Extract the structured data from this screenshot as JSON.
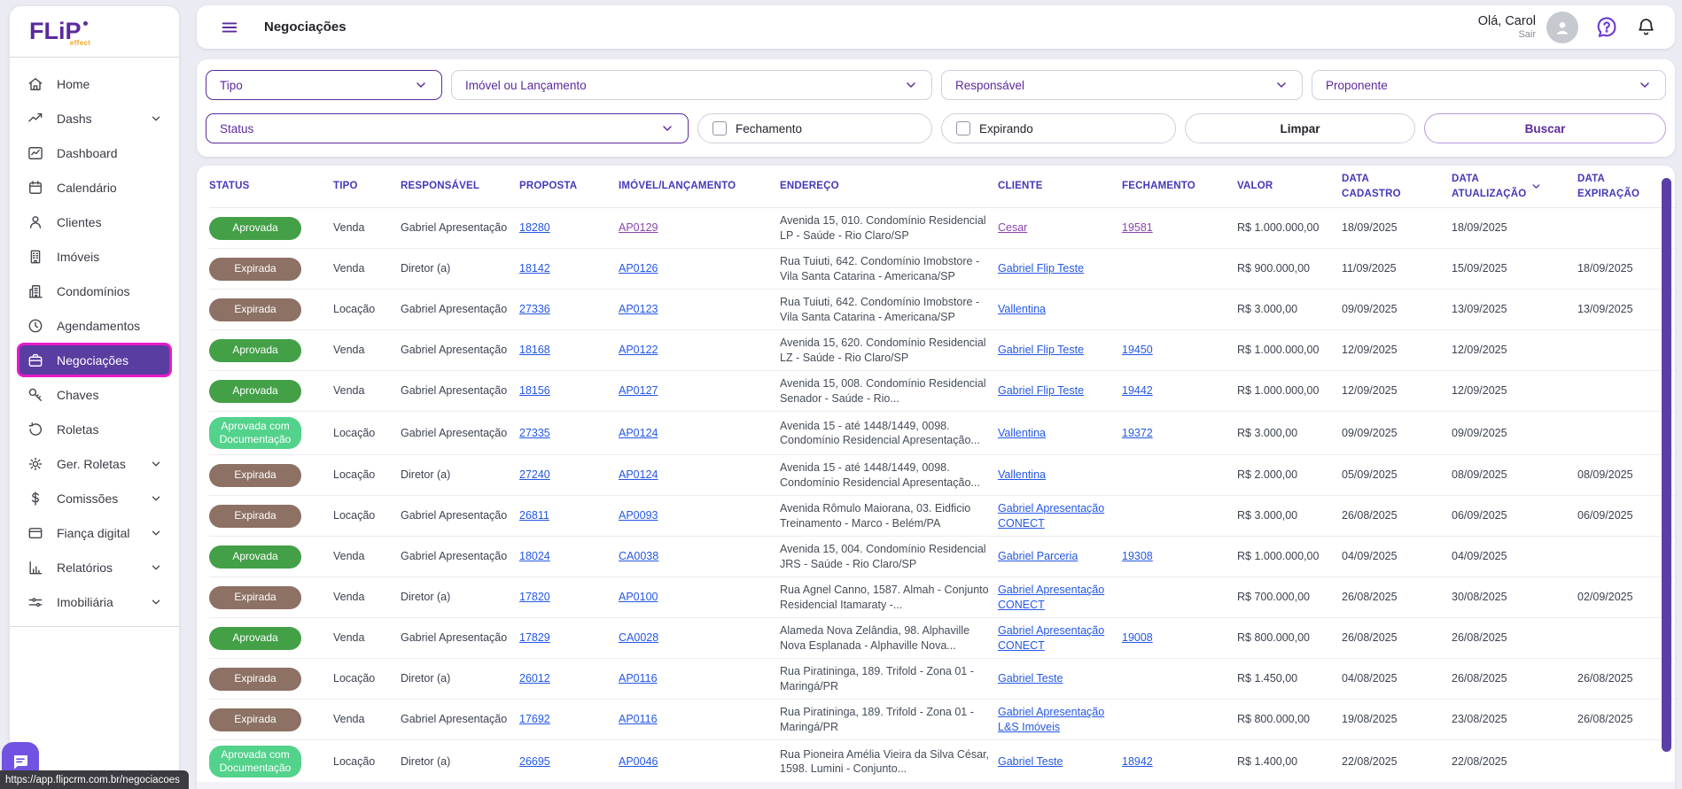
{
  "brand": {
    "name": "FLiP",
    "suffix": "effect"
  },
  "topbar": {
    "title": "Negociações",
    "greeting": "Olá, Carol",
    "logout": "Sair"
  },
  "filters": {
    "tipo": "Tipo",
    "imovel": "Imóvel ou Lançamento",
    "responsavel": "Responsável",
    "proponente": "Proponente",
    "status": "Status",
    "fechamento": "Fechamento",
    "expirando": "Expirando",
    "limpar": "Limpar",
    "buscar": "Buscar"
  },
  "sidebar": {
    "items": [
      {
        "label": "Home",
        "icon": "home"
      },
      {
        "label": "Dashs",
        "icon": "trending",
        "chevron": true
      },
      {
        "label": "Dashboard",
        "icon": "line-chart"
      },
      {
        "label": "Calendário",
        "icon": "calendar"
      },
      {
        "label": "Clientes",
        "icon": "person"
      },
      {
        "label": "Imóveis",
        "icon": "building"
      },
      {
        "label": "Condomínios",
        "icon": "buildings"
      },
      {
        "label": "Agendamentos",
        "icon": "clock"
      },
      {
        "label": "Negociações",
        "icon": "briefcase",
        "active": true
      },
      {
        "label": "Chaves",
        "icon": "key"
      },
      {
        "label": "Roletas",
        "icon": "rotate"
      },
      {
        "label": "Ger. Roletas",
        "icon": "gear",
        "chevron": true
      },
      {
        "label": "Comissões",
        "icon": "dollar",
        "chevron": true
      },
      {
        "label": "Fiança digital",
        "icon": "card",
        "chevron": true
      },
      {
        "label": "Relatórios",
        "icon": "bar-chart",
        "chevron": true
      },
      {
        "label": "Imobiliária",
        "icon": "sliders",
        "chevron": true
      }
    ]
  },
  "table": {
    "columns": [
      {
        "label": "STATUS"
      },
      {
        "label": "TIPO"
      },
      {
        "label": "RESPONSÁVEL"
      },
      {
        "label": "PROPOSTA"
      },
      {
        "label": "IMÓVEL/LANÇAMENTO"
      },
      {
        "label": "ENDEREÇO"
      },
      {
        "label": "CLIENTE"
      },
      {
        "label": "FECHAMENTO"
      },
      {
        "label": "VALOR"
      },
      {
        "label": "DATA\nCADASTRO"
      },
      {
        "label": "DATA\nATUALIZAÇÃO",
        "sort": true
      },
      {
        "label": "DATA\nEXPIRAÇÃO"
      }
    ],
    "rows": [
      {
        "status": "Aprovada",
        "tipo": "Venda",
        "responsavel": "Gabriel Apresentação",
        "proposta": "18280",
        "imovel": "AP0129",
        "endereco": "Avenida 15, 010. Condomínio Residencial LP - Saúde - Rio Claro/SP",
        "cliente": "Cesar",
        "fechamento": "19581",
        "valor": "R$ 1.000.000,00",
        "cadastro": "18/09/2025",
        "atualizacao": "18/09/2025",
        "expiracao": "",
        "visited": true
      },
      {
        "status": "Expirada",
        "tipo": "Venda",
        "responsavel": "Diretor (a)",
        "proposta": "18142",
        "imovel": "AP0126",
        "endereco": "Rua Tuiuti, 642. Condomínio Imobstore - Vila Santa Catarina - Americana/SP",
        "cliente": "Gabriel Flip Teste",
        "fechamento": "",
        "valor": "R$ 900.000,00",
        "cadastro": "11/09/2025",
        "atualizacao": "15/09/2025",
        "expiracao": "18/09/2025"
      },
      {
        "status": "Expirada",
        "tipo": "Locação",
        "responsavel": "Gabriel Apresentação",
        "proposta": "27336",
        "imovel": "AP0123",
        "endereco": "Rua Tuiuti, 642. Condomínio Imobstore - Vila Santa Catarina - Americana/SP",
        "cliente": "Vallentina",
        "fechamento": "",
        "valor": "R$ 3.000,00",
        "cadastro": "09/09/2025",
        "atualizacao": "13/09/2025",
        "expiracao": "13/09/2025"
      },
      {
        "status": "Aprovada",
        "tipo": "Venda",
        "responsavel": "Gabriel Apresentação",
        "proposta": "18168",
        "imovel": "AP0122",
        "endereco": "Avenida 15, 620. Condomínio Residencial LZ - Saúde - Rio Claro/SP",
        "cliente": "Gabriel Flip Teste",
        "fechamento": "19450",
        "valor": "R$ 1.000.000,00",
        "cadastro": "12/09/2025",
        "atualizacao": "12/09/2025",
        "expiracao": ""
      },
      {
        "status": "Aprovada",
        "tipo": "Venda",
        "responsavel": "Gabriel Apresentação",
        "proposta": "18156",
        "imovel": "AP0127",
        "endereco": "Avenida 15, 008. Condomínio Residencial Senador - Saúde - Rio...",
        "cliente": "Gabriel Flip Teste",
        "fechamento": "19442",
        "valor": "R$ 1.000.000,00",
        "cadastro": "12/09/2025",
        "atualizacao": "12/09/2025",
        "expiracao": ""
      },
      {
        "status": "Aprovada com Documentação",
        "tipo": "Locação",
        "responsavel": "Gabriel Apresentação",
        "proposta": "27335",
        "imovel": "AP0124",
        "endereco": "Avenida 15 - até 1448/1449, 0098. Condomínio Residencial Apresentação...",
        "cliente": "Vallentina",
        "fechamento": "19372",
        "valor": "R$ 3.000,00",
        "cadastro": "09/09/2025",
        "atualizacao": "09/09/2025",
        "expiracao": ""
      },
      {
        "status": "Expirada",
        "tipo": "Locação",
        "responsavel": "Diretor (a)",
        "proposta": "27240",
        "imovel": "AP0124",
        "endereco": "Avenida 15 - até 1448/1449, 0098. Condomínio Residencial Apresentação...",
        "cliente": "Vallentina",
        "fechamento": "",
        "valor": "R$ 2.000,00",
        "cadastro": "05/09/2025",
        "atualizacao": "08/09/2025",
        "expiracao": "08/09/2025"
      },
      {
        "status": "Expirada",
        "tipo": "Locação",
        "responsavel": "Gabriel Apresentação",
        "proposta": "26811",
        "imovel": "AP0093",
        "endereco": "Avenida Rômulo Maiorana, 03. Eidficio Treinamento - Marco - Belém/PA",
        "cliente": "Gabriel Apresentação CONECT",
        "fechamento": "",
        "valor": "R$ 3.000,00",
        "cadastro": "26/08/2025",
        "atualizacao": "06/09/2025",
        "expiracao": "06/09/2025"
      },
      {
        "status": "Aprovada",
        "tipo": "Venda",
        "responsavel": "Gabriel Apresentação",
        "proposta": "18024",
        "imovel": "CA0038",
        "endereco": "Avenida 15, 004. Condomínio Residencial JRS - Saúde - Rio Claro/SP",
        "cliente": "Gabriel Parceria",
        "fechamento": "19308",
        "valor": "R$ 1.000.000,00",
        "cadastro": "04/09/2025",
        "atualizacao": "04/09/2025",
        "expiracao": ""
      },
      {
        "status": "Expirada",
        "tipo": "Venda",
        "responsavel": "Diretor (a)",
        "proposta": "17820",
        "imovel": "AP0100",
        "endereco": "Rua Agnel Canno, 1587. Almah - Conjunto Residencial Itamaraty -...",
        "cliente": "Gabriel Apresentação CONECT",
        "fechamento": "",
        "valor": "R$ 700.000,00",
        "cadastro": "26/08/2025",
        "atualizacao": "30/08/2025",
        "expiracao": "02/09/2025"
      },
      {
        "status": "Aprovada",
        "tipo": "Venda",
        "responsavel": "Gabriel Apresentação",
        "proposta": "17829",
        "imovel": "CA0028",
        "endereco": "Alameda Nova Zelândia, 98. Alphaville Nova Esplanada - Alphaville Nova...",
        "cliente": "Gabriel Apresentação CONECT",
        "fechamento": "19008",
        "valor": "R$ 800.000,00",
        "cadastro": "26/08/2025",
        "atualizacao": "26/08/2025",
        "expiracao": ""
      },
      {
        "status": "Expirada",
        "tipo": "Locação",
        "responsavel": "Diretor (a)",
        "proposta": "26012",
        "imovel": "AP0116",
        "endereco": "Rua Piratininga, 189. Trifold - Zona 01 - Maringá/PR",
        "cliente": "Gabriel Teste",
        "fechamento": "",
        "valor": "R$ 1.450,00",
        "cadastro": "04/08/2025",
        "atualizacao": "26/08/2025",
        "expiracao": "26/08/2025"
      },
      {
        "status": "Expirada",
        "tipo": "Venda",
        "responsavel": "Gabriel Apresentação",
        "proposta": "17692",
        "imovel": "AP0116",
        "endereco": "Rua Piratininga, 189. Trifold - Zona 01 - Maringá/PR",
        "cliente": "Gabriel Apresentação L&S Imóveis",
        "fechamento": "",
        "valor": "R$ 800.000,00",
        "cadastro": "19/08/2025",
        "atualizacao": "23/08/2025",
        "expiracao": "26/08/2025"
      },
      {
        "status": "Aprovada com Documentação",
        "tipo": "Locação",
        "responsavel": "Diretor (a)",
        "proposta": "26695",
        "imovel": "AP0046",
        "endereco": "Rua Pioneira Amélia Vieira da Silva César, 1598. Lumini - Conjunto...",
        "cliente": "Gabriel Teste",
        "fechamento": "18942",
        "valor": "R$ 1.400,00",
        "cadastro": "22/08/2025",
        "atualizacao": "22/08/2025",
        "expiracao": ""
      }
    ]
  },
  "statusbar": {
    "url": "https://app.flipcrm.com.br/negociacoes"
  },
  "colors": {
    "brand_purple": "#5b2a9d",
    "active_item_bg": "#5a3da0",
    "active_item_border": "#e51bc8",
    "approved_green": "#43a047",
    "expired_brown": "#8c7164",
    "approved_doc_green": "#53d28c",
    "link_blue": "#2457e6",
    "link_visited": "#8e44ad",
    "table_header_text": "#4538b8"
  }
}
